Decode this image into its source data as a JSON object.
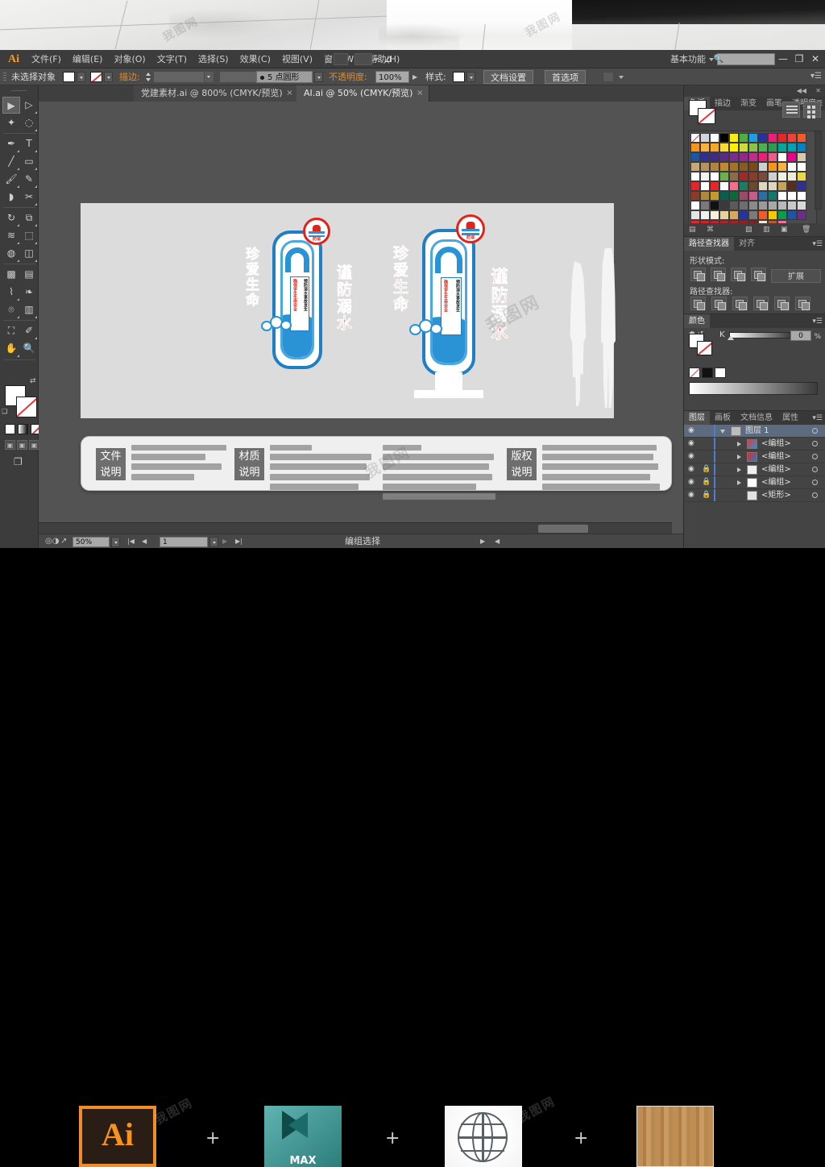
{
  "app": {
    "logo": "Ai",
    "workspace": "基本功能",
    "search_placeholder": "",
    "window_buttons": [
      "—",
      "❐",
      "✕"
    ]
  },
  "menu": {
    "items": [
      "文件(F)",
      "编辑(E)",
      "对象(O)",
      "文字(T)",
      "选择(S)",
      "效果(C)",
      "视图(V)",
      "窗口(W)",
      "帮助(H)"
    ]
  },
  "control_bar": {
    "selection_status": "未选择对象",
    "stroke_label": "描边:",
    "stroke_weight": "",
    "brush_label": "5 点圆形",
    "opacity_label": "不透明度:",
    "opacity_value": "100%",
    "style_label": "样式:",
    "doc_setup_button": "文档设置",
    "preferences_button": "首选项"
  },
  "document_tabs": [
    {
      "label": "党建素材.ai @ 800% (CMYK/预览)",
      "active": false,
      "close": "×"
    },
    {
      "label": "AI.ai @ 50% (CMYK/预览)",
      "active": true,
      "close": "×"
    }
  ],
  "toolbox": {
    "tools": [
      "selection-tool",
      "direct-selection-tool",
      "magic-wand-tool",
      "lasso-tool",
      "pen-tool",
      "type-tool",
      "line-segment-tool",
      "rectangle-tool",
      "paintbrush-tool",
      "pencil-tool",
      "blob-brush-tool",
      "scissors-tool",
      "rotate-tool",
      "scale-tool",
      "width-tool",
      "free-transform-tool",
      "shape-builder-tool",
      "perspective-grid-tool",
      "mesh-tool",
      "gradient-tool",
      "eyedropper-tool",
      "blend-tool",
      "symbol-sprayer-tool",
      "column-graph-tool",
      "artboard-tool",
      "slice-tool",
      "hand-tool",
      "zoom-tool"
    ],
    "selected_tool": "selection-tool",
    "fill_color": "#ffffff",
    "stroke_color": "none"
  },
  "canvas": {
    "artboard_bg": "#dcdcdc",
    "signs": [
      {
        "title_left": "珍爱生命",
        "title_right": "谨防溺水",
        "center_lines": [
          "预防溺水事故发生",
          "确保学生生命安全"
        ],
        "badge_label": "防溺",
        "has_pedestal": false
      },
      {
        "title_left": "珍爱生命",
        "title_right": "谨防溺水",
        "center_lines": [
          "预防溺水事故发生",
          "确保学生生命安全"
        ],
        "badge_label": "防溺",
        "has_pedestal": true
      }
    ],
    "scale_figures": [
      "female-silhouette",
      "male-silhouette"
    ],
    "description_panel": {
      "badges": [
        "文件\n说明",
        "材质\n说明",
        "版权\n说明"
      ],
      "col1_lines": 4,
      "col2_lines": 5,
      "col3_lines": 6,
      "col4_lines": 5
    }
  },
  "status_bar": {
    "zoom": "50%",
    "page": "1",
    "tool_name": "编组选择"
  },
  "panels": {
    "swatches": {
      "tabs": [
        "色板",
        "描边",
        "渐变",
        "画笔",
        "透明度"
      ],
      "active_tab": "色板",
      "fill": "#ffffff",
      "stroke": "none",
      "rows": [
        [
          "#ffffff",
          "#cfd6df",
          "#ffffff",
          "#000000",
          "#f7ec13",
          "#4caf3f",
          "#1aa0e0",
          "#2433a0",
          "#ec1e79",
          "#e8252a",
          "#ef4136",
          "#f15a29",
          "#f7941e",
          "#fbb040",
          "#f9a825",
          "#fdd835",
          "#fff200"
        ],
        [
          "#cddc39",
          "#8bc34a",
          "#4caf50",
          "#2e9b4e",
          "#00a896",
          "#00a2b5",
          "#0083c7",
          "#1b55a6",
          "#2e3192",
          "#3f2a86",
          "#5a2d82",
          "#7b2d8c",
          "#92278f",
          "#c42b8f",
          "#ec1e79",
          "#f05a8c",
          "#ffffff"
        ],
        [
          "#ec008c",
          "#d8c9ae",
          "#c8a878",
          "#b99060",
          "#b0853f",
          "#c08a2e",
          "#a4732a",
          "#8a5a22",
          "#7a4a1c",
          "#cfcfcf",
          "#f7941e",
          "#fbb040",
          "#ffffff",
          "#ffffff",
          "#ffffff",
          "#f2f2f2",
          "#ffffff"
        ],
        [
          "#6ab04c",
          "#8a6b4a",
          "#9e2b2b",
          "#8c3a2a",
          "#7a4a3a",
          "#cfcfcf",
          "#efefe4",
          "#f0ebd8",
          "#e8d84a",
          "#e8252a",
          "#ffffff",
          "#e8252a",
          "#ffffff",
          "#ef6f8c",
          "#1f7a5f",
          "#6b4a2a",
          "#e0d6c0"
        ],
        [
          "#e0d6c0",
          "#c8a45a",
          "#5a2d1c",
          "#2e3192",
          "#8c3a2a",
          "#b08a3a",
          "#c89a2a",
          "#0b5c52",
          "#0a6b3a",
          "#9c4a6a",
          "#c95a8a",
          "#2a6fa8",
          "#0f7a6a",
          "#ffffff",
          "#ffffff",
          "#ffffff",
          "#ffffff"
        ],
        [
          "#7a7a7a",
          "#111111",
          "#3a3a3a",
          "#5a5a5a",
          "#6e6e6e",
          "#8a8a8a",
          "#9a9a9a",
          "#a8a8a8",
          "#b8b8b8",
          "#c8c8c8",
          "#d8d8d8",
          "#e4e4e4",
          "#f0f0f0",
          "#f7f0dd",
          "#e8cfa0",
          "#d8a95a",
          "#2433a0"
        ],
        [
          "#7a7a7a",
          "#f15a29",
          "#f7c800",
          "#0a9e4a",
          "#1b55a6",
          "#6b2d8c",
          "#e8252a",
          "#d81f26",
          "#c41f26",
          "#b41f26",
          "#a41f26",
          "#941f26",
          "#841f26",
          "#f0e6d8",
          "#b85a2a",
          "#ef6f9c"
        ]
      ]
    },
    "pathfinder": {
      "tabs": [
        "路径查找器",
        "对齐"
      ],
      "active_tab": "路径查找器",
      "shape_modes_label": "形状模式:",
      "expand_button": "扩展",
      "pathfinders_label": "路径查找器:"
    },
    "color": {
      "title": "颜色",
      "channel": "K",
      "value": "0",
      "unit": "%"
    },
    "layers": {
      "tabs": [
        "图层",
        "画板",
        "文档信息",
        "属性"
      ],
      "active_tab": "图层",
      "rows": [
        {
          "name": "图层 1",
          "selected": true,
          "locked": false,
          "expandable": true,
          "expanded": true
        },
        {
          "name": "<编组>",
          "selected": false,
          "locked": false,
          "expandable": true,
          "expanded": false
        },
        {
          "name": "<编组>",
          "selected": false,
          "locked": false,
          "expandable": true,
          "expanded": false
        },
        {
          "name": "<编组>",
          "selected": false,
          "locked": true,
          "expandable": true,
          "expanded": false
        },
        {
          "name": "<编组>",
          "selected": false,
          "locked": true,
          "expandable": true,
          "expanded": false
        },
        {
          "name": "<矩形>",
          "selected": false,
          "locked": true,
          "expandable": false,
          "expanded": false
        }
      ]
    }
  },
  "bottom_strip": {
    "icons": [
      {
        "name": "illustrator-icon",
        "label": "Ai"
      },
      {
        "name": "plus-separator",
        "label": "+"
      },
      {
        "name": "3dsmax-icon",
        "label": "MAX"
      },
      {
        "name": "plus-separator",
        "label": "+"
      },
      {
        "name": "web-globe-icon",
        "label": ""
      },
      {
        "name": "plus-separator",
        "label": "+"
      },
      {
        "name": "wood-texture-icon",
        "label": ""
      }
    ]
  },
  "watermark": {
    "text": "我图网"
  }
}
